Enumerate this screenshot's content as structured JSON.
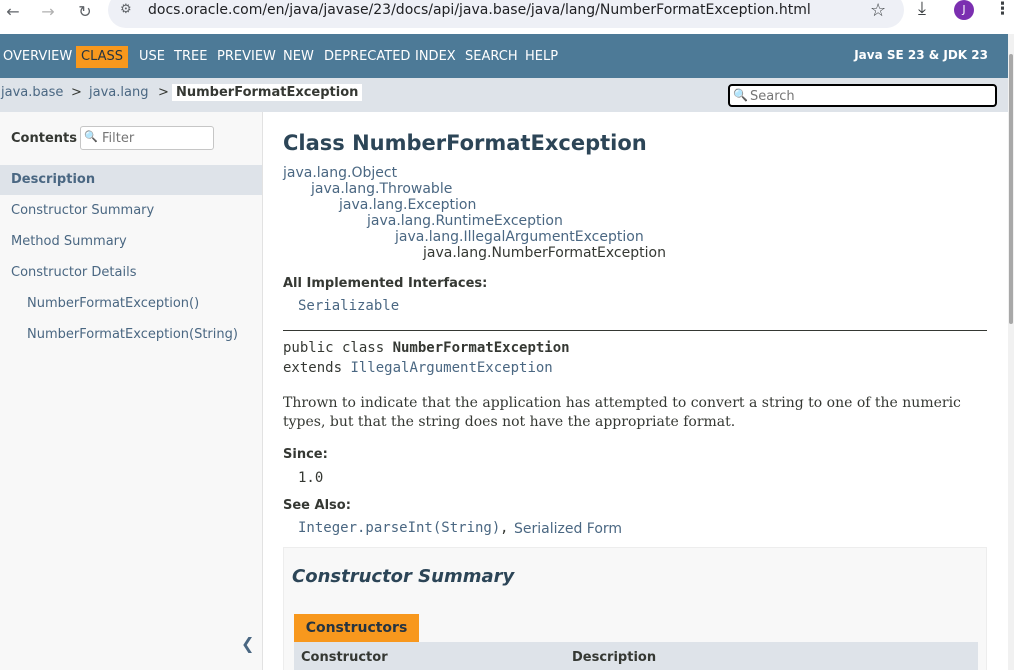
{
  "browser": {
    "url": "docs.oracle.com/en/java/javase/23/docs/api/java.base/java/lang/NumberFormatException.html",
    "avatar_letter": "J"
  },
  "topnav": {
    "items": [
      "OVERVIEW",
      "CLASS",
      "USE",
      "TREE",
      "PREVIEW",
      "NEW",
      "DEPRECATED",
      "INDEX",
      "SEARCH",
      "HELP"
    ],
    "about": "Java SE 23 & JDK 23"
  },
  "breadcrumb": {
    "module": "java.base",
    "package": "java.lang",
    "current": "NumberFormatException",
    "sep": ">"
  },
  "search": {
    "placeholder": "Search"
  },
  "sidebar": {
    "contents_label": "Contents",
    "filter_placeholder": "Filter",
    "items": [
      {
        "label": "Description"
      },
      {
        "label": "Constructor Summary"
      },
      {
        "label": "Method Summary"
      },
      {
        "label": "Constructor Details"
      },
      {
        "label": "NumberFormatException()"
      },
      {
        "label": "NumberFormatException(String)"
      }
    ]
  },
  "main": {
    "title": "Class NumberFormatException",
    "hierarchy": [
      "java.lang.Object",
      "java.lang.Throwable",
      "java.lang.Exception",
      "java.lang.RuntimeException",
      "java.lang.IllegalArgumentException",
      "java.lang.NumberFormatException"
    ],
    "interfaces_label": "All Implemented Interfaces:",
    "interfaces": "Serializable",
    "decl_prefix": "public class ",
    "decl_name": "NumberFormatException",
    "extends_kw": "extends ",
    "extends_link": "IllegalArgumentException",
    "description": "Thrown to indicate that the application has attempted to convert a string to one of the numeric types, but that the string does not have the appropriate format.",
    "since_label": "Since:",
    "since_value": "1.0",
    "see_also_label": "See Also:",
    "see_also_1": "Integer.parseInt(String)",
    "see_also_sep": ",",
    "see_also_2": "Serialized Form",
    "summary_title": "Constructor Summary",
    "summary_tab": "Constructors",
    "col_constructor": "Constructor",
    "col_description": "Description"
  }
}
